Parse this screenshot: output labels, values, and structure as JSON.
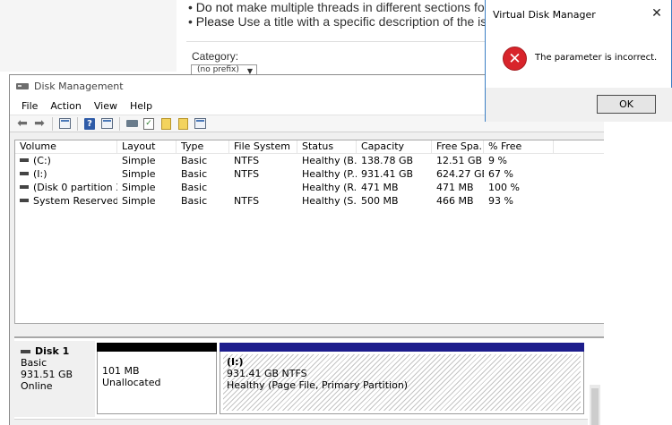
{
  "background_page": {
    "line1_bold": "Do not",
    "line1_rest": " make multiple threads in different sections fo",
    "line2_bold": "Please",
    "line2_rest": " Use a title with a specific description of the iss",
    "category_label": "Category:",
    "category_select_value": "(no prefix)",
    "bullet": "•"
  },
  "disk_management": {
    "title": "Disk Management",
    "menu": [
      "File",
      "Action",
      "View",
      "Help"
    ],
    "toolbar_icons": [
      "back-arrow-icon",
      "forward-arrow-icon",
      "console-tree-icon",
      "help-icon",
      "properties-icon",
      "disk-icon",
      "checklist-icon",
      "up-folder-icon",
      "search-icon",
      "window-icon"
    ],
    "columns": [
      "Volume",
      "Layout",
      "Type",
      "File System",
      "Status",
      "Capacity",
      "Free Spa...",
      "% Free"
    ],
    "volumes": [
      {
        "volume": "(C:)",
        "layout": "Simple",
        "type": "Basic",
        "fs": "NTFS",
        "status": "Healthy (B...",
        "capacity": "138.78 GB",
        "free": "12.51 GB",
        "pct": "9 %"
      },
      {
        "volume": "(I:)",
        "layout": "Simple",
        "type": "Basic",
        "fs": "NTFS",
        "status": "Healthy (P...",
        "capacity": "931.41 GB",
        "free": "624.27 GB",
        "pct": "67 %"
      },
      {
        "volume": "(Disk 0 partition 3)",
        "layout": "Simple",
        "type": "Basic",
        "fs": "",
        "status": "Healthy (R...",
        "capacity": "471 MB",
        "free": "471 MB",
        "pct": "100 %"
      },
      {
        "volume": "System Reserved",
        "layout": "Simple",
        "type": "Basic",
        "fs": "NTFS",
        "status": "Healthy (S...",
        "capacity": "500 MB",
        "free": "466 MB",
        "pct": "93 %"
      }
    ],
    "disk": {
      "name": "Disk 1",
      "type": "Basic",
      "size": "931.51 GB",
      "state": "Online",
      "unallocated": {
        "size": "101 MB",
        "label": "Unallocated"
      },
      "partition": {
        "name": "(I:)",
        "size": "931.41 GB NTFS",
        "status": "Healthy (Page File, Primary Partition)"
      }
    }
  },
  "dialog": {
    "title": "Virtual Disk Manager",
    "close_glyph": "✕",
    "message": "The parameter is incorrect.",
    "ok_label": "OK",
    "error_glyph": "✕"
  },
  "colors": {
    "primary_partition_bar": "#1d1d8c",
    "unallocated_bar": "#000000",
    "error_red": "#d8242b",
    "dialog_border": "#3b7fc4"
  }
}
